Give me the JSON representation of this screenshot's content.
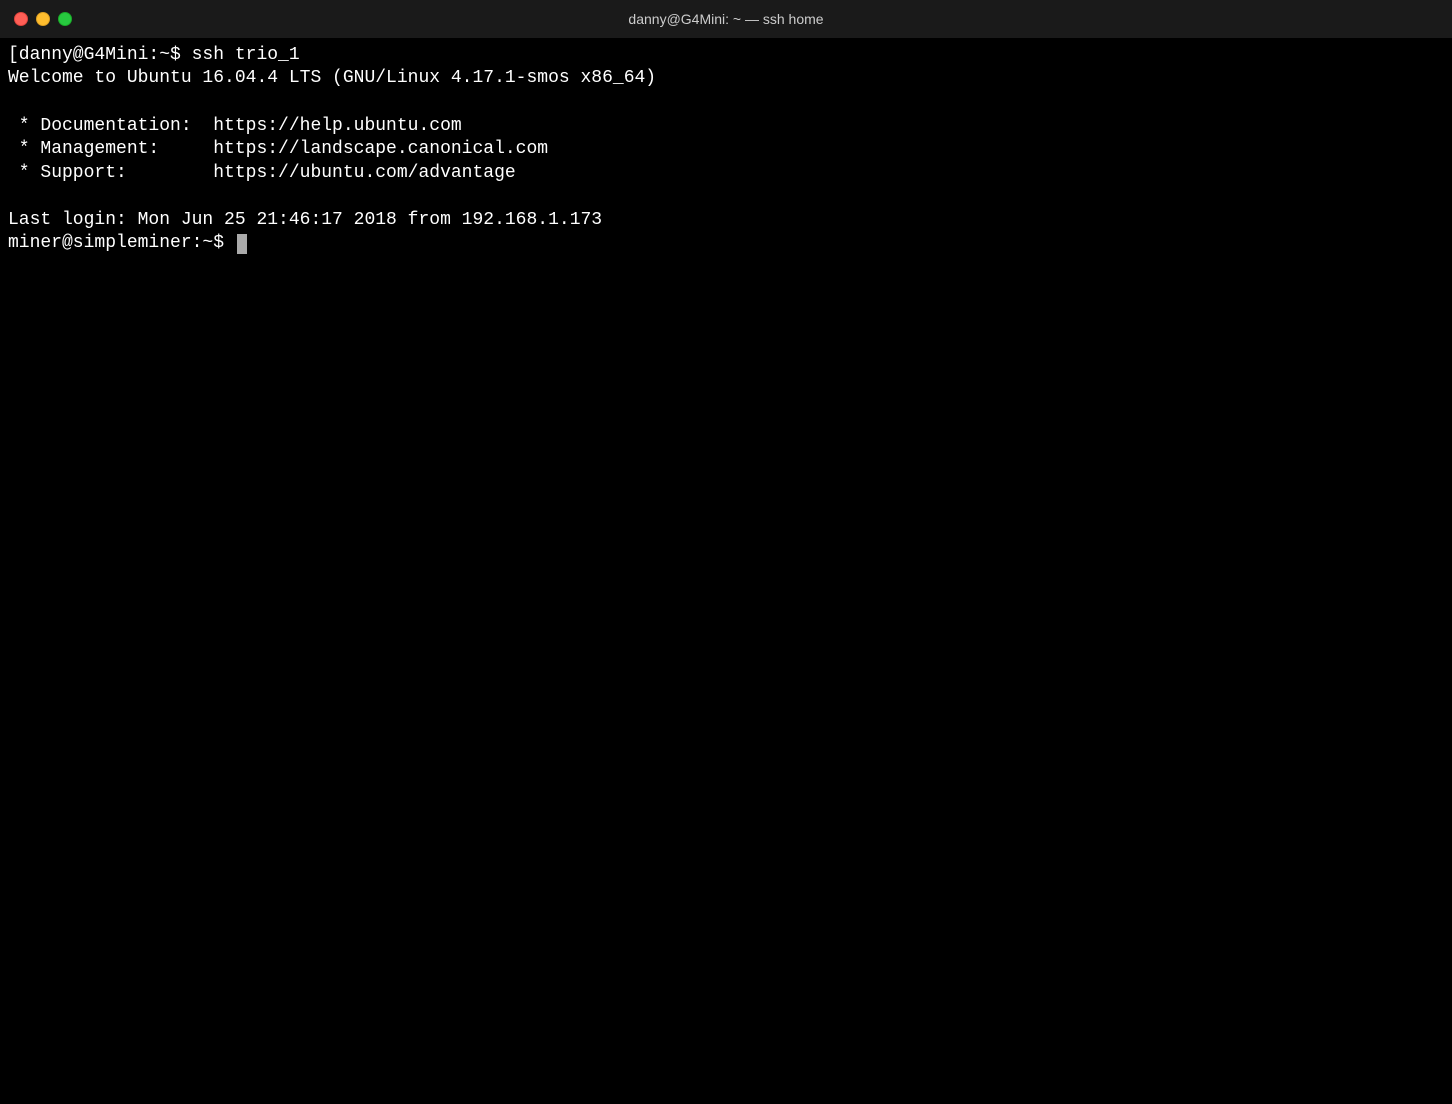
{
  "window": {
    "title": "danny@G4Mini: ~ — ssh home",
    "traffic_lights": {
      "close_label": "close",
      "minimize_label": "minimize",
      "maximize_label": "maximize"
    }
  },
  "terminal": {
    "lines": [
      "[danny@G4Mini:~$ ssh trio_1",
      "Welcome to Ubuntu 16.04.4 LTS (GNU/Linux 4.17.1-smos x86_64)",
      "",
      " * Documentation:  https://help.ubuntu.com",
      " * Management:     https://landscape.canonical.com",
      " * Support:        https://ubuntu.com/advantage",
      "",
      "Last login: Mon Jun 25 21:46:17 2018 from 192.168.1.173"
    ],
    "prompt": "miner@simpleminer:~$ "
  }
}
